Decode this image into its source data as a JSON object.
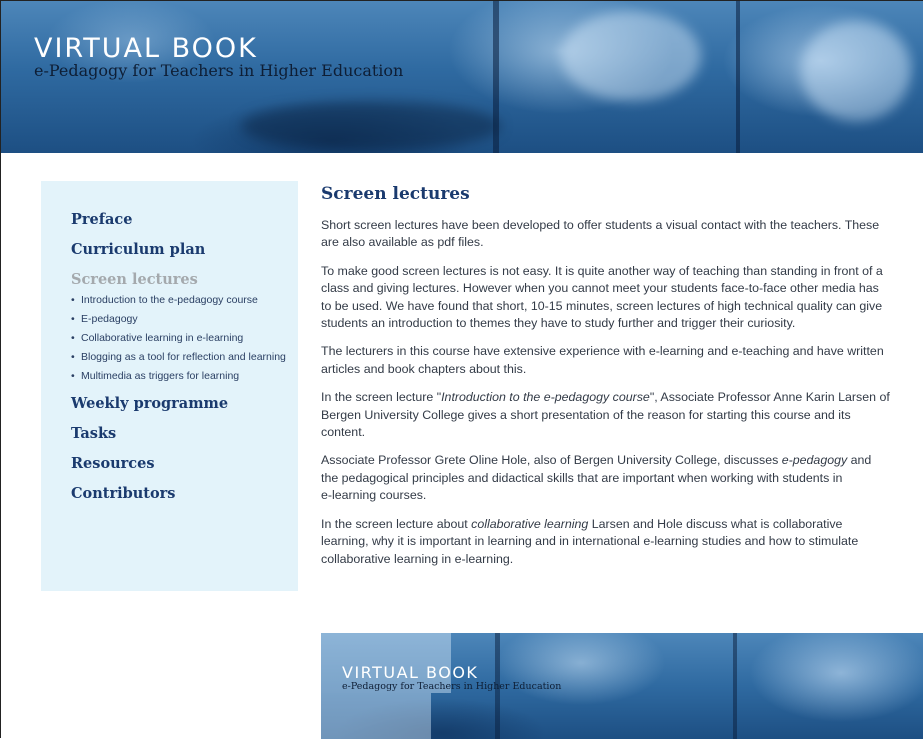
{
  "header": {
    "title": "VIRTUAL BOOK",
    "subtitle": "e-Pedagogy for Teachers in Higher Education"
  },
  "sidebar": {
    "items": [
      {
        "label": "Preface"
      },
      {
        "label": "Curriculum plan"
      },
      {
        "label": "Screen lectures",
        "current": true,
        "subitems": [
          "Introduction to the e-pedagogy course",
          "E-pedagogy",
          "Collaborative learning in e-learning",
          "Blogging as a tool for reflection and learning",
          "Multimedia as triggers for learning"
        ]
      },
      {
        "label": "Weekly programme"
      },
      {
        "label": "Tasks"
      },
      {
        "label": "Resources"
      },
      {
        "label": "Contributors"
      }
    ]
  },
  "main": {
    "title": "Screen lectures",
    "paragraphs": [
      [
        {
          "t": "Short screen lectures have been developed to offer students a visual contact with the teachers. These"
        },
        {
          "br": true
        },
        {
          "t": "are also available as pdf files."
        }
      ],
      [
        {
          "t": "To make good screen lectures is not easy. It is quite another way of teaching than standing in front of a"
        },
        {
          "br": true
        },
        {
          "t": "class and giving lectures. However when you cannot meet your students face-to-face other media has"
        },
        {
          "br": true
        },
        {
          "t": "to be used. We have found that short, 10-15 minutes, screen lectures of high technical quality can give"
        },
        {
          "br": true
        },
        {
          "t": "students an introduction to themes they have to study further and trigger their curiosity."
        }
      ],
      [
        {
          "t": "The lecturers in this course have extensive experience with e-learning and e-teaching and have written"
        },
        {
          "br": true
        },
        {
          "t": "articles and book chapters about this."
        }
      ],
      [
        {
          "t": "In the screen lecture \""
        },
        {
          "t": "Introduction to the e-pedagogy course",
          "i": true
        },
        {
          "t": "\", Associate Professor Anne Karin Larsen of"
        },
        {
          "br": true
        },
        {
          "t": "Bergen University College gives a short presentation of the reason for starting this course and its"
        },
        {
          "br": true
        },
        {
          "t": "content."
        }
      ],
      [
        {
          "t": "Associate Professor Grete Oline Hole, also of Bergen University College, discusses "
        },
        {
          "t": "e-pedagogy",
          "i": true
        },
        {
          "t": " and"
        },
        {
          "br": true
        },
        {
          "t": "the pedagogical principles and didactical skills that are important when working with students in"
        },
        {
          "br": true
        },
        {
          "t": "e-learning courses."
        }
      ],
      [
        {
          "t": "In the screen lecture about "
        },
        {
          "t": "collaborative learning",
          "i": true
        },
        {
          "t": " Larsen and Hole discuss what is collaborative"
        },
        {
          "br": true
        },
        {
          "t": "learning, why it is important in learning and in international e-learning studies and how to stimulate"
        },
        {
          "br": true
        },
        {
          "t": "collaborative learning in e-learning."
        }
      ]
    ]
  },
  "footer_banner": {
    "title": "VIRTUAL BOOK",
    "subtitle": "e-Pedagogy for Teachers in Higher Education"
  },
  "colors": {
    "nav_link": "#1a3a6e",
    "nav_current": "#a4a9ad",
    "sidebar_bg": "#e3f3fa",
    "banner_blue": "#2f6aa1"
  }
}
